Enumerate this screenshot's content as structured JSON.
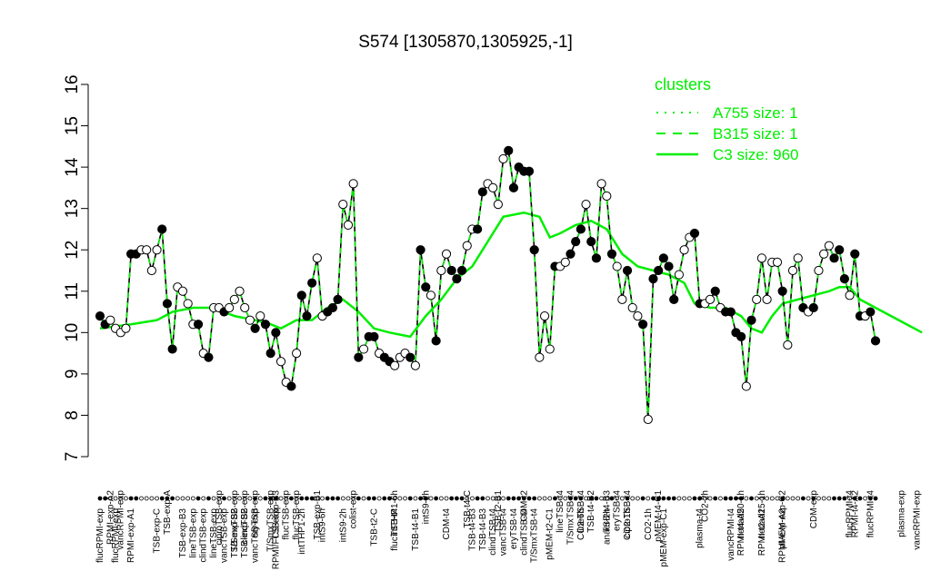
{
  "chart_data": {
    "type": "line",
    "title": "S574 [1305870,1305925,-1]",
    "xlabel": "",
    "ylabel": "",
    "ylim": [
      7,
      16
    ],
    "yticks": [
      7,
      8,
      9,
      10,
      11,
      12,
      13,
      14,
      15,
      16
    ],
    "grid": false,
    "legend": {
      "title": "clusters",
      "position": "top-right",
      "entries": [
        {
          "label": "A755 size: 1",
          "style": "dotted"
        },
        {
          "label": "B315 size: 1",
          "style": "dashed"
        },
        {
          "label": "C3 size: 960",
          "style": "solid"
        }
      ]
    },
    "colors": {
      "series": "#00ee00",
      "connector": "#000000",
      "point_open": "#ffffff",
      "point_filled": "#000000"
    },
    "x_labels_top": [
      {
        "i": 2,
        "label": "RPMI-exp-A2"
      },
      {
        "i": 4,
        "label": "vancRPMI-exp"
      },
      {
        "i": 13,
        "label": "TSB-exp-A"
      },
      {
        "i": 23,
        "label": "ciproTSB-exp"
      },
      {
        "i": 26,
        "label": "T/SmxTSB-exp"
      },
      {
        "i": 28,
        "label": "clindTSB-exp"
      },
      {
        "i": 30,
        "label": "eryTSB-exp"
      },
      {
        "i": 33,
        "label": "T/SmxTSB-exp"
      },
      {
        "i": 34,
        "label": "TSB-exp-B3"
      },
      {
        "i": 36,
        "label": "flucTSB-exp"
      },
      {
        "i": 38,
        "label": "flucTSB-exp"
      },
      {
        "i": 42,
        "label": "TSB-exp-B1"
      },
      {
        "i": 49,
        "label": "colist-exp"
      },
      {
        "i": 57,
        "label": "intTHP1-6h"
      },
      {
        "i": 63,
        "label": "intS9-2h"
      },
      {
        "i": 71,
        "label": "TSB-t4-C"
      },
      {
        "i": 77,
        "label": "TSB-t2-B1"
      },
      {
        "i": 82,
        "label": "CDM-t2"
      },
      {
        "i": 89,
        "label": "lineTSB-t4"
      },
      {
        "i": 91,
        "label": "T/SmxTSB-t4"
      },
      {
        "i": 93,
        "label": "lineTSB-t4"
      },
      {
        "i": 95,
        "label": "TSB-t4-B2"
      },
      {
        "i": 98,
        "label": "TSB-t4-B3"
      },
      {
        "i": 100,
        "label": "eryTSB-t4"
      },
      {
        "i": 102,
        "label": "ciproTSB-t4"
      },
      {
        "i": 108,
        "label": "pMEM-t4-C1"
      },
      {
        "i": 117,
        "label": "CO2-2h"
      },
      {
        "i": 124,
        "label": "nonad50-1h"
      },
      {
        "i": 128,
        "label": "nonad25-1h"
      },
      {
        "i": 132,
        "label": "pMEM-exp-C2"
      },
      {
        "i": 138,
        "label": "CDM-exp"
      },
      {
        "i": 145,
        "label": "flucRPMI-t4"
      },
      {
        "i": 146,
        "label": "RPMI-t4-A2"
      },
      {
        "i": 149,
        "label": "flucRPMI-t4"
      },
      {
        "i": 155,
        "label": "plasma-exp"
      },
      {
        "i": 158,
        "label": "vancRPMI-exp"
      }
    ],
    "x_labels_bottom": [
      {
        "i": 0,
        "label": "flucRPMI-exp"
      },
      {
        "i": 3,
        "label": "flucRPMI-exp"
      },
      {
        "i": 6,
        "label": "RPMI-exp-A1"
      },
      {
        "i": 11,
        "label": "TSB-exp-C"
      },
      {
        "i": 16,
        "label": "TSB-exp-B3"
      },
      {
        "i": 18,
        "label": "lineTSB-exp"
      },
      {
        "i": 20,
        "label": "clindTSB-exp"
      },
      {
        "i": 22,
        "label": "lineTSB-exp"
      },
      {
        "i": 24,
        "label": "vancTSB-exp"
      },
      {
        "i": 26,
        "label": "TSB-exp-B2"
      },
      {
        "i": 28,
        "label": "TSB-exp-B2"
      },
      {
        "i": 30,
        "label": "vancTSB-exp"
      },
      {
        "i": 34,
        "label": "RPMI/FCS-exp"
      },
      {
        "i": 39,
        "label": "intTHP1-2h"
      },
      {
        "i": 43,
        "label": "intS9-6h"
      },
      {
        "i": 47,
        "label": "intS9-2h"
      },
      {
        "i": 53,
        "label": "TSB-t2-C"
      },
      {
        "i": 57,
        "label": "flucTSB-t4"
      },
      {
        "i": 61,
        "label": "TSB-t4-B1"
      },
      {
        "i": 67,
        "label": "CDM-t4"
      },
      {
        "i": 72,
        "label": "TSB-t4-B3"
      },
      {
        "i": 74,
        "label": "TSB-t4-B3"
      },
      {
        "i": 76,
        "label": "clindTSB-t4"
      },
      {
        "i": 78,
        "label": "vancTSB-t4"
      },
      {
        "i": 80,
        "label": "eryTSB-t4"
      },
      {
        "i": 82,
        "label": "clindTSB-t4"
      },
      {
        "i": 84,
        "label": "T/SmxTSB-t4"
      },
      {
        "i": 87,
        "label": "pMEM-t2-C1"
      },
      {
        "i": 93,
        "label": "CO2-6h"
      },
      {
        "i": 98,
        "label": "anaer-2h"
      },
      {
        "i": 102,
        "label": "CO2-1h"
      },
      {
        "i": 106,
        "label": "CO2-1h"
      },
      {
        "i": 109,
        "label": "pMEM-exp-C1"
      },
      {
        "i": 116,
        "label": "plasma-t4"
      },
      {
        "i": 122,
        "label": "vancRPMI-t4"
      },
      {
        "i": 124,
        "label": "RPMI-t4-A2"
      },
      {
        "i": 128,
        "label": "RPMI-t2-A1"
      },
      {
        "i": 132,
        "label": "RPMI-exp-A2"
      }
    ],
    "points": [
      10.4,
      10.2,
      10.3,
      10.1,
      10.0,
      10.1,
      11.9,
      11.9,
      12.0,
      12.0,
      11.5,
      12.0,
      12.5,
      10.7,
      9.6,
      11.1,
      11.0,
      10.7,
      10.2,
      10.2,
      9.5,
      9.4,
      10.6,
      10.6,
      10.5,
      10.6,
      10.8,
      11.0,
      10.6,
      10.3,
      10.1,
      10.4,
      10.2,
      9.5,
      10.0,
      9.3,
      8.8,
      8.7,
      9.5,
      10.9,
      10.4,
      11.2,
      11.8,
      10.4,
      10.5,
      10.6,
      10.8,
      13.1,
      12.6,
      13.6,
      9.4,
      9.6,
      9.9,
      9.9,
      9.5,
      9.4,
      9.3,
      9.2,
      9.4,
      9.5,
      9.4,
      9.2,
      12.0,
      11.1,
      10.9,
      9.8,
      11.5,
      11.9,
      11.5,
      11.3,
      11.5,
      12.1,
      12.5,
      12.5,
      13.4,
      13.6,
      13.5,
      13.1,
      14.2,
      14.4,
      13.5,
      14.0,
      13.9,
      13.9,
      12.0,
      9.4,
      10.4,
      9.6,
      11.6,
      11.6,
      11.7,
      11.9,
      12.2,
      12.5,
      13.1,
      12.2,
      11.8,
      13.6,
      13.3,
      11.9,
      11.6,
      10.8,
      11.5,
      10.6,
      10.4,
      10.2,
      7.9,
      11.3,
      11.5,
      11.8,
      11.6,
      10.8,
      11.4,
      12.0,
      12.3,
      12.4,
      10.7,
      10.7,
      10.8,
      11.0,
      10.6,
      10.5,
      10.5,
      10.0,
      9.9,
      8.7,
      10.3,
      10.8,
      11.8,
      10.8,
      11.7,
      11.7,
      11.0,
      9.7,
      11.5,
      11.8,
      10.6,
      10.5,
      10.6,
      11.5,
      11.9,
      12.1,
      11.8,
      12.0,
      11.3,
      10.9,
      11.9,
      10.4,
      10.4,
      10.5,
      9.8
    ],
    "open_points": [
      2,
      3,
      4,
      5,
      8,
      9,
      10,
      11,
      15,
      16,
      17,
      18,
      20,
      22,
      23,
      25,
      26,
      27,
      28,
      29,
      31,
      35,
      36,
      38,
      42,
      43,
      47,
      48,
      49,
      51,
      54,
      57,
      58,
      59,
      61,
      64,
      66,
      67,
      71,
      72,
      75,
      76,
      77,
      78,
      85,
      86,
      87,
      89,
      90,
      94,
      97,
      98,
      100,
      101,
      103,
      104,
      106,
      112,
      113,
      114,
      117,
      118,
      120,
      125,
      127,
      128,
      129,
      130,
      131,
      133,
      134,
      135,
      137,
      139,
      140,
      141,
      145,
      148,
      152,
      153,
      158
    ],
    "cluster_curve": [
      [
        0,
        10.1
      ],
      [
        6,
        10.2
      ],
      [
        11,
        10.3
      ],
      [
        14,
        10.5
      ],
      [
        18,
        10.6
      ],
      [
        22,
        10.6
      ],
      [
        26,
        10.4
      ],
      [
        30,
        10.3
      ],
      [
        33,
        10.2
      ],
      [
        35,
        10.1
      ],
      [
        38,
        10.3
      ],
      [
        41,
        10.3
      ],
      [
        44,
        10.6
      ],
      [
        47,
        10.8
      ],
      [
        50,
        10.5
      ],
      [
        53,
        10.1
      ],
      [
        56,
        10.0
      ],
      [
        60,
        9.9
      ],
      [
        63,
        10.4
      ],
      [
        66,
        10.8
      ],
      [
        69,
        11.3
      ],
      [
        72,
        11.6
      ],
      [
        75,
        12.2
      ],
      [
        78,
        12.8
      ],
      [
        82,
        12.9
      ],
      [
        85,
        12.8
      ],
      [
        87,
        12.3
      ],
      [
        89,
        12.4
      ],
      [
        92,
        12.6
      ],
      [
        95,
        12.7
      ],
      [
        98,
        12.5
      ],
      [
        101,
        11.9
      ],
      [
        104,
        11.6
      ],
      [
        107,
        11.5
      ],
      [
        110,
        11.4
      ],
      [
        113,
        11.2
      ],
      [
        115,
        10.7
      ],
      [
        118,
        10.6
      ],
      [
        121,
        10.6
      ],
      [
        124,
        10.4
      ],
      [
        126,
        10.1
      ],
      [
        128,
        10.0
      ],
      [
        130,
        10.4
      ],
      [
        132,
        10.7
      ],
      [
        135,
        10.8
      ],
      [
        138,
        10.9
      ],
      [
        141,
        11.0
      ],
      [
        143,
        11.1
      ],
      [
        145,
        11.1
      ],
      [
        147,
        10.8
      ],
      [
        150,
        10.6
      ],
      [
        153,
        10.4
      ],
      [
        156,
        10.2
      ],
      [
        159,
        10.0
      ]
    ]
  }
}
